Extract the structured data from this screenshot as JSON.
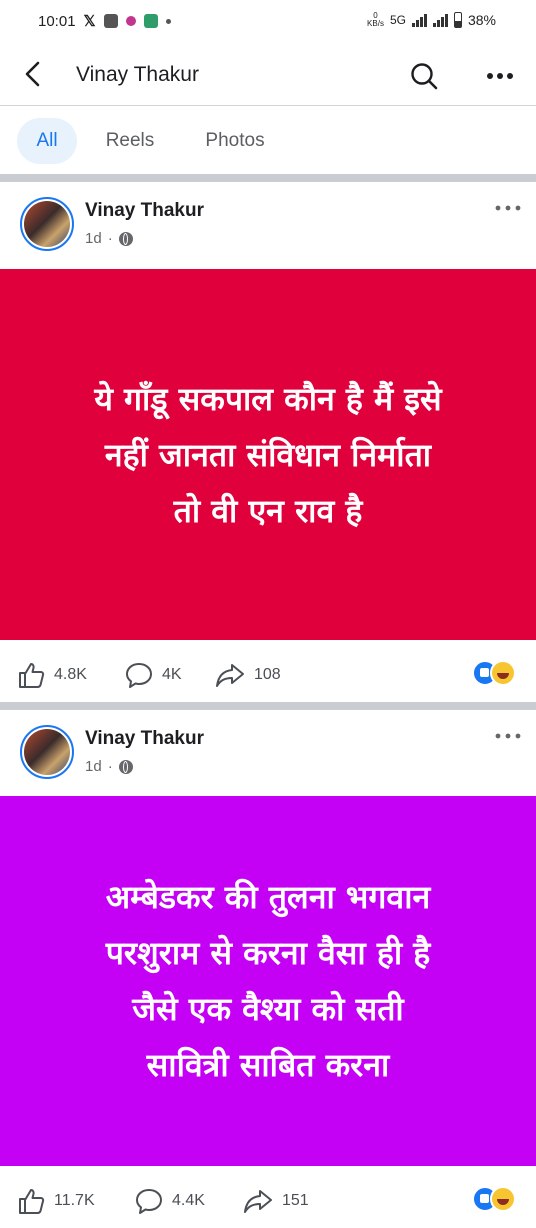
{
  "status_bar": {
    "time": "10:01",
    "network": "5G",
    "battery": "38%",
    "data_rate_value": "0",
    "data_rate_unit": "KB/s"
  },
  "header": {
    "title": "Vinay Thakur",
    "back_icon": "back-arrow-icon",
    "search_icon": "search-icon",
    "more_icon": "more-horizontal-icon"
  },
  "tabs": [
    {
      "label": "All",
      "active": true
    },
    {
      "label": "Reels",
      "active": false
    },
    {
      "label": "Photos",
      "active": false
    }
  ],
  "posts": [
    {
      "author": "Vinay Thakur",
      "time": "1d",
      "privacy_icon": "globe-icon",
      "background_color": "#e0003b",
      "text": "ये गाँडू सकपाल कौन है मैं इसे\nनहीं जानता संविधान निर्माता\nतो वी एन राव है",
      "likes": "4.8K",
      "comments": "4K",
      "shares": "108",
      "reactions": [
        "like",
        "haha"
      ]
    },
    {
      "author": "Vinay Thakur",
      "time": "1d",
      "privacy_icon": "globe-icon",
      "background_color": "#c400f5",
      "text": "अम्बेडकर की तुलना भगवान\nपरशुराम से करना वैसा ही है\nजैसे एक वैश्या को सती\nसावित्री साबित करना",
      "likes": "11.7K",
      "comments": "4.4K",
      "shares": "151",
      "reactions": [
        "like",
        "haha"
      ]
    }
  ]
}
